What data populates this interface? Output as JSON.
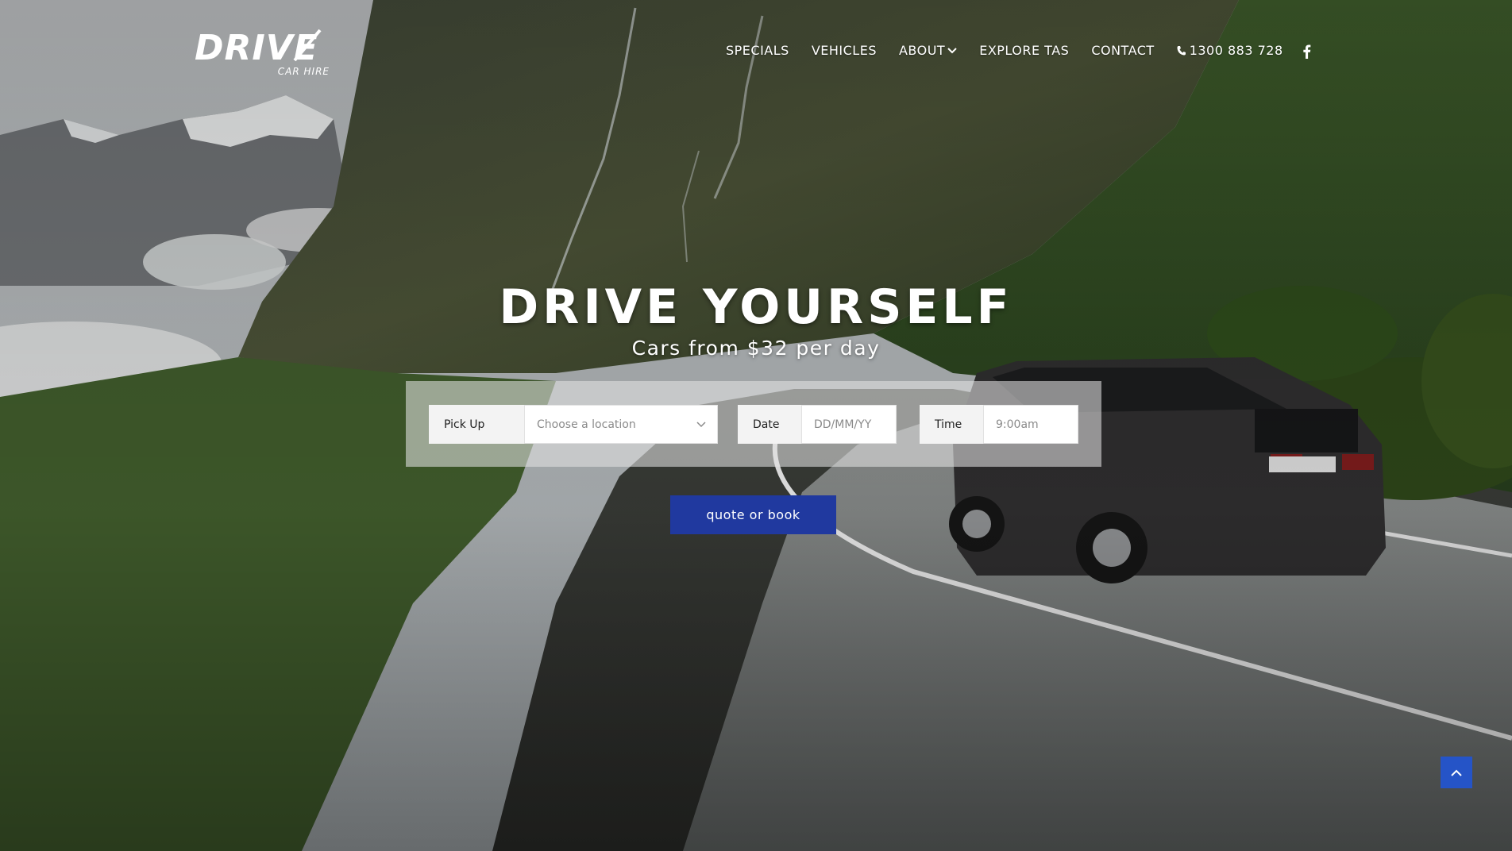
{
  "brand": {
    "logo_text": "DRIVE",
    "logo_subtext": "CAR HIRE"
  },
  "nav": {
    "items": [
      {
        "label": "SPECIALS"
      },
      {
        "label": "VEHICLES"
      },
      {
        "label": "ABOUT"
      },
      {
        "label": "EXPLORE TAS"
      },
      {
        "label": "CONTACT"
      }
    ],
    "phone": "1300 883 728",
    "social_icon": "facebook-icon"
  },
  "hero": {
    "title": "DRIVE YOURSELF",
    "subtitle": "Cars from $32 per day"
  },
  "booking": {
    "pickup_label": "Pick Up",
    "pickup_placeholder": "Choose a location",
    "date_label": "Date",
    "date_placeholder": "DD/MM/YY",
    "time_label": "Time",
    "time_value": "9:00am",
    "submit_label": "quote or book"
  },
  "colors": {
    "accent": "#20399f",
    "scroll_top": "#2554c7"
  },
  "icons": {
    "scroll_top": "chevron-up-icon",
    "dropdown": "chevron-down-icon",
    "phone": "phone-icon"
  }
}
